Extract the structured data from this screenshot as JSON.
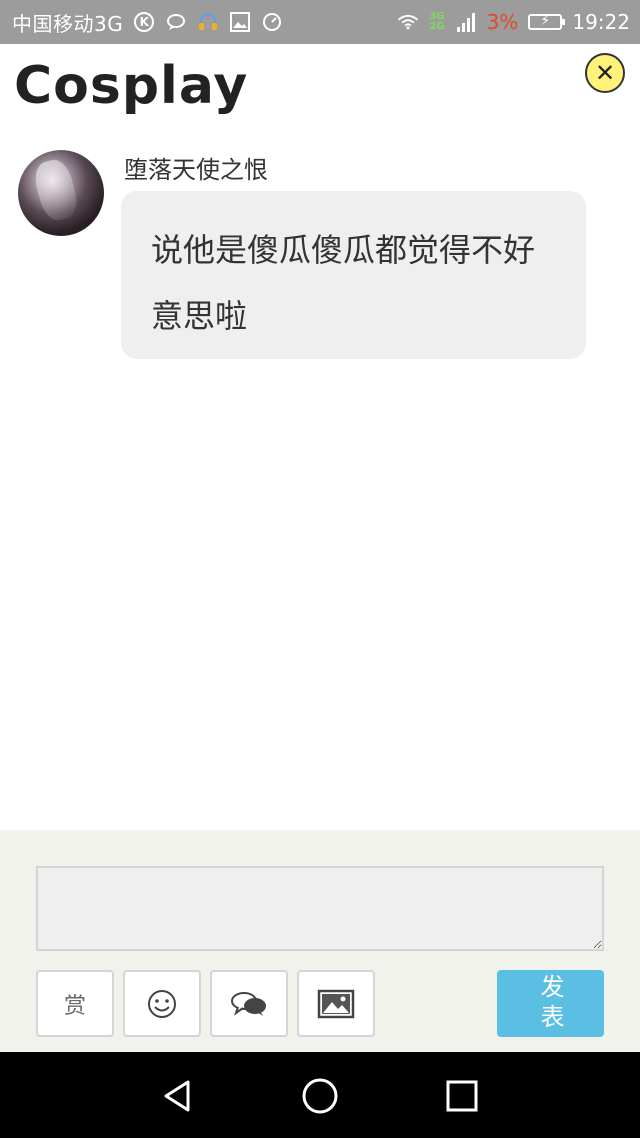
{
  "status_bar": {
    "carrier": "中国移动3G",
    "net_top": "3G",
    "net_bottom": "2G",
    "battery": "3%",
    "time": "19:22"
  },
  "header": {
    "title": "Cosplay",
    "close_icon": "close-icon"
  },
  "message": {
    "sender": "堕落天使之恨",
    "text": "说他是傻瓜傻瓜都觉得不好意思啦"
  },
  "composer": {
    "input_value": "",
    "tools": [
      {
        "name": "reward",
        "label": "赏",
        "icon": "reward-icon"
      },
      {
        "name": "emoji",
        "icon": "emoji-icon"
      },
      {
        "name": "chat",
        "icon": "chat-bubbles-icon"
      },
      {
        "name": "image",
        "icon": "image-icon"
      }
    ],
    "publish_label": "发表",
    "publish_color": "#5bbfe3"
  },
  "nav": {
    "back_icon": "back-icon",
    "home_icon": "home-icon",
    "recents_icon": "recents-icon"
  }
}
